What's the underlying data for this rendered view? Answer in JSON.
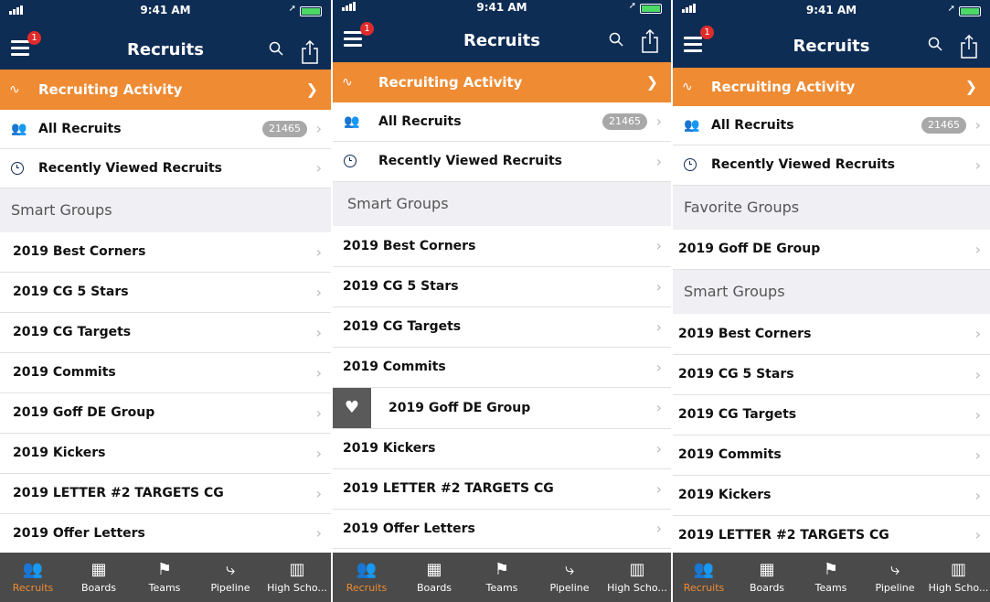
{
  "status": {
    "time": "9:41 AM"
  },
  "header": {
    "title": "Recruits",
    "badge": "1"
  },
  "activity": {
    "label": "Recruiting Activity"
  },
  "all_recruits": {
    "label": "All Recruits",
    "count": "21465"
  },
  "recent": {
    "label": "Recently Viewed Recruits"
  },
  "sections": {
    "smart": "Smart Groups",
    "favorite": "Favorite Groups"
  },
  "groups": [
    "2019 Best Corners",
    "2019 CG 5 Stars",
    "2019 CG Targets",
    "2019 Commits",
    "2019 Goff DE Group",
    "2019 Kickers",
    "2019 LETTER #2 TARGETS CG",
    "2019 Offer Letters"
  ],
  "favorite_groups": [
    "2019 Goff DE Group"
  ],
  "tabs": [
    "Recruits",
    "Boards",
    "Teams",
    "Pipeline",
    "High Scho..."
  ],
  "icons": {
    "menu": "hamburger-menu-icon",
    "search": "search-icon",
    "share": "share-icon",
    "activity": "pulse-icon",
    "recruits": "people-icon",
    "recent": "clock-icon",
    "favorite": "heart-icon",
    "chevron": "chevron-right-icon"
  },
  "colors": {
    "navy": "#0e2d55",
    "orange": "#ee8b33",
    "tabbar": "#4a4a4a",
    "section": "#efeff4",
    "badge": "#e02b2b"
  }
}
